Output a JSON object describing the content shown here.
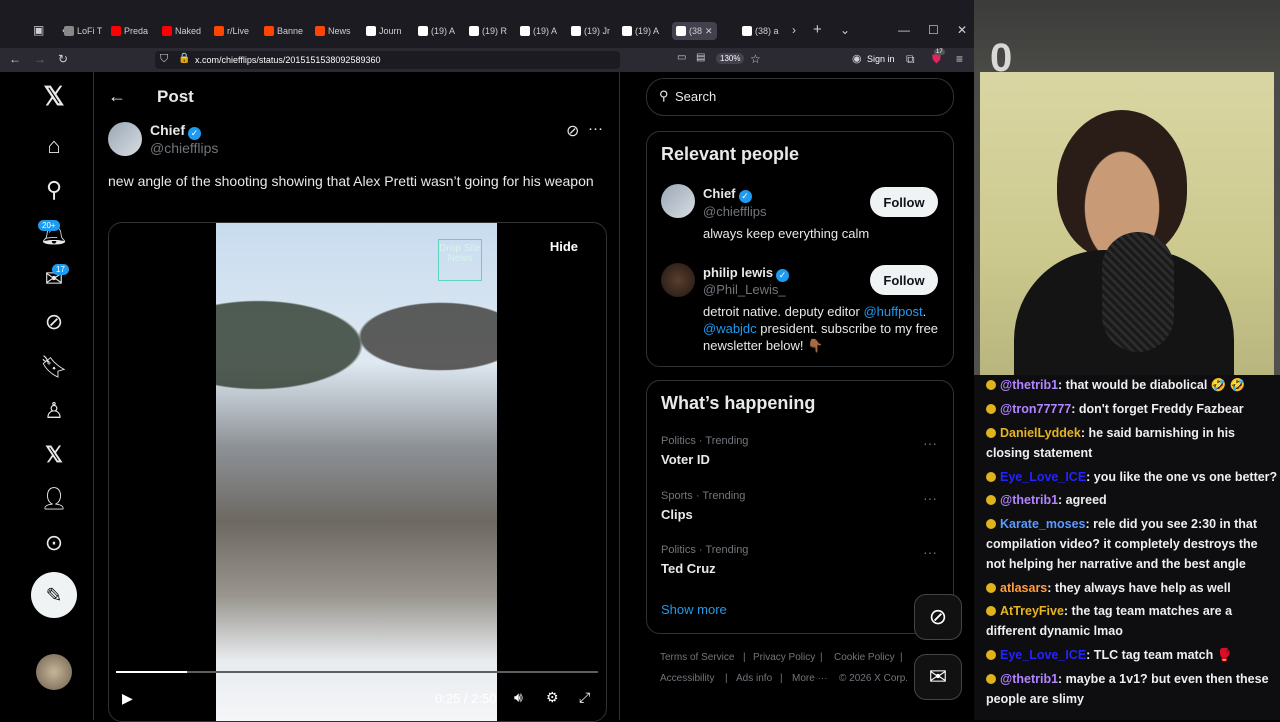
{
  "browser": {
    "tabs": [
      {
        "label": "LoFi T",
        "color": "#888888"
      },
      {
        "label": "Preda",
        "color": "#ff0000"
      },
      {
        "label": "Naked",
        "color": "#ff0000"
      },
      {
        "label": "r/Live",
        "color": "#ff4500"
      },
      {
        "label": "Banne",
        "color": "#ff4500"
      },
      {
        "label": "News",
        "color": "#ff4500"
      },
      {
        "label": "Journ",
        "color": "#ffffff"
      },
      {
        "label": "(19) A",
        "color": "#ffffff"
      },
      {
        "label": "(19) R",
        "color": "#ffffff"
      },
      {
        "label": "(19) A",
        "color": "#ffffff"
      },
      {
        "label": "(19) Jr",
        "color": "#ffffff"
      },
      {
        "label": "(19) A",
        "color": "#ffffff"
      },
      {
        "label": "(38",
        "color": "#ffffff"
      },
      {
        "label": "(38) a",
        "color": "#ffffff"
      }
    ],
    "url": "x.com/chiefflips/status/2015151538092589360",
    "zoom": "130%",
    "sign_in": "Sign in",
    "ext_badge": "17"
  },
  "sidebar": {
    "notifications_badge": "20+",
    "messages_badge": "17"
  },
  "post": {
    "header": "Post",
    "author_name": "Chief",
    "author_handle": "@chiefflips",
    "text": "new angle of the shooting showing that Alex Pretti wasn’t going for his weapon",
    "video_logo": "Drop Site News",
    "hide_label": "Hide",
    "time": "0:25 / 2:50",
    "progress": 0.147
  },
  "right": {
    "search_placeholder": "Search",
    "relevant_title": "Relevant people",
    "people": [
      {
        "name": "Chief",
        "handle": "@chiefflips",
        "bio": "always keep everything calm",
        "follow": "Follow"
      },
      {
        "name": "philip lewis",
        "handle": "@Phil_Lewis_",
        "bio_a": "detroit native. deputy editor ",
        "bio_link1": "@huffpost",
        "bio_b": ". ",
        "bio_link2": "@wabjdc",
        "bio_c": " president. subscribe to my free newsletter below! 👇🏾",
        "follow": "Follow"
      }
    ],
    "happening_title": "What’s happening",
    "trends": [
      {
        "meta": "Politics · Trending",
        "name": "Voter ID"
      },
      {
        "meta": "Sports · Trending",
        "name": "Clips"
      },
      {
        "meta": "Politics · Trending",
        "name": "Ted Cruz"
      }
    ],
    "show_more": "Show more",
    "footer_line1": [
      "Terms of Service",
      "Privacy Policy",
      "Cookie Policy"
    ],
    "footer_line2": [
      "Accessibility",
      "Ads info",
      "More ···",
      "© 2026 X Corp."
    ]
  },
  "stream": {
    "counter": "0",
    "chat": [
      {
        "user": "@thetrib1",
        "user_color": "#b185ff",
        "text": ": that would be diabolical 🤣 🤣"
      },
      {
        "user": "@tron77777",
        "user_color": "#b185ff",
        "text": ": don't forget Freddy Fazbear"
      },
      {
        "user": "DanielLyddek",
        "user_color": "#e6b422",
        "text": ": he said barnishing in his closing statement"
      },
      {
        "user": "Eye_Love_ICE",
        "user_color": "#2323ff",
        "text": ": you like the one vs one better?"
      },
      {
        "user": "@thetrib1",
        "user_color": "#b185ff",
        "text": ": agreed"
      },
      {
        "user": "Karate_moses",
        "user_color": "#5a9bff",
        "text": ": rele did you see 2:30 in that compilation video? it completely destroys the not helping her narrative and the best angle"
      },
      {
        "user": "atlasars",
        "user_color": "#ff9f40",
        "text": ": they always have help as well"
      },
      {
        "user": "AtTreyFive",
        "user_color": "#e6b422",
        "text": ": the tag team matches are a different dynamic lmao"
      },
      {
        "user": "Eye_Love_ICE",
        "user_color": "#2323ff",
        "text": ": TLC tag team match 🥊"
      },
      {
        "user": "@thetrib1",
        "user_color": "#b185ff",
        "text": ": maybe a 1v1? but even then these people are slimy"
      }
    ]
  }
}
